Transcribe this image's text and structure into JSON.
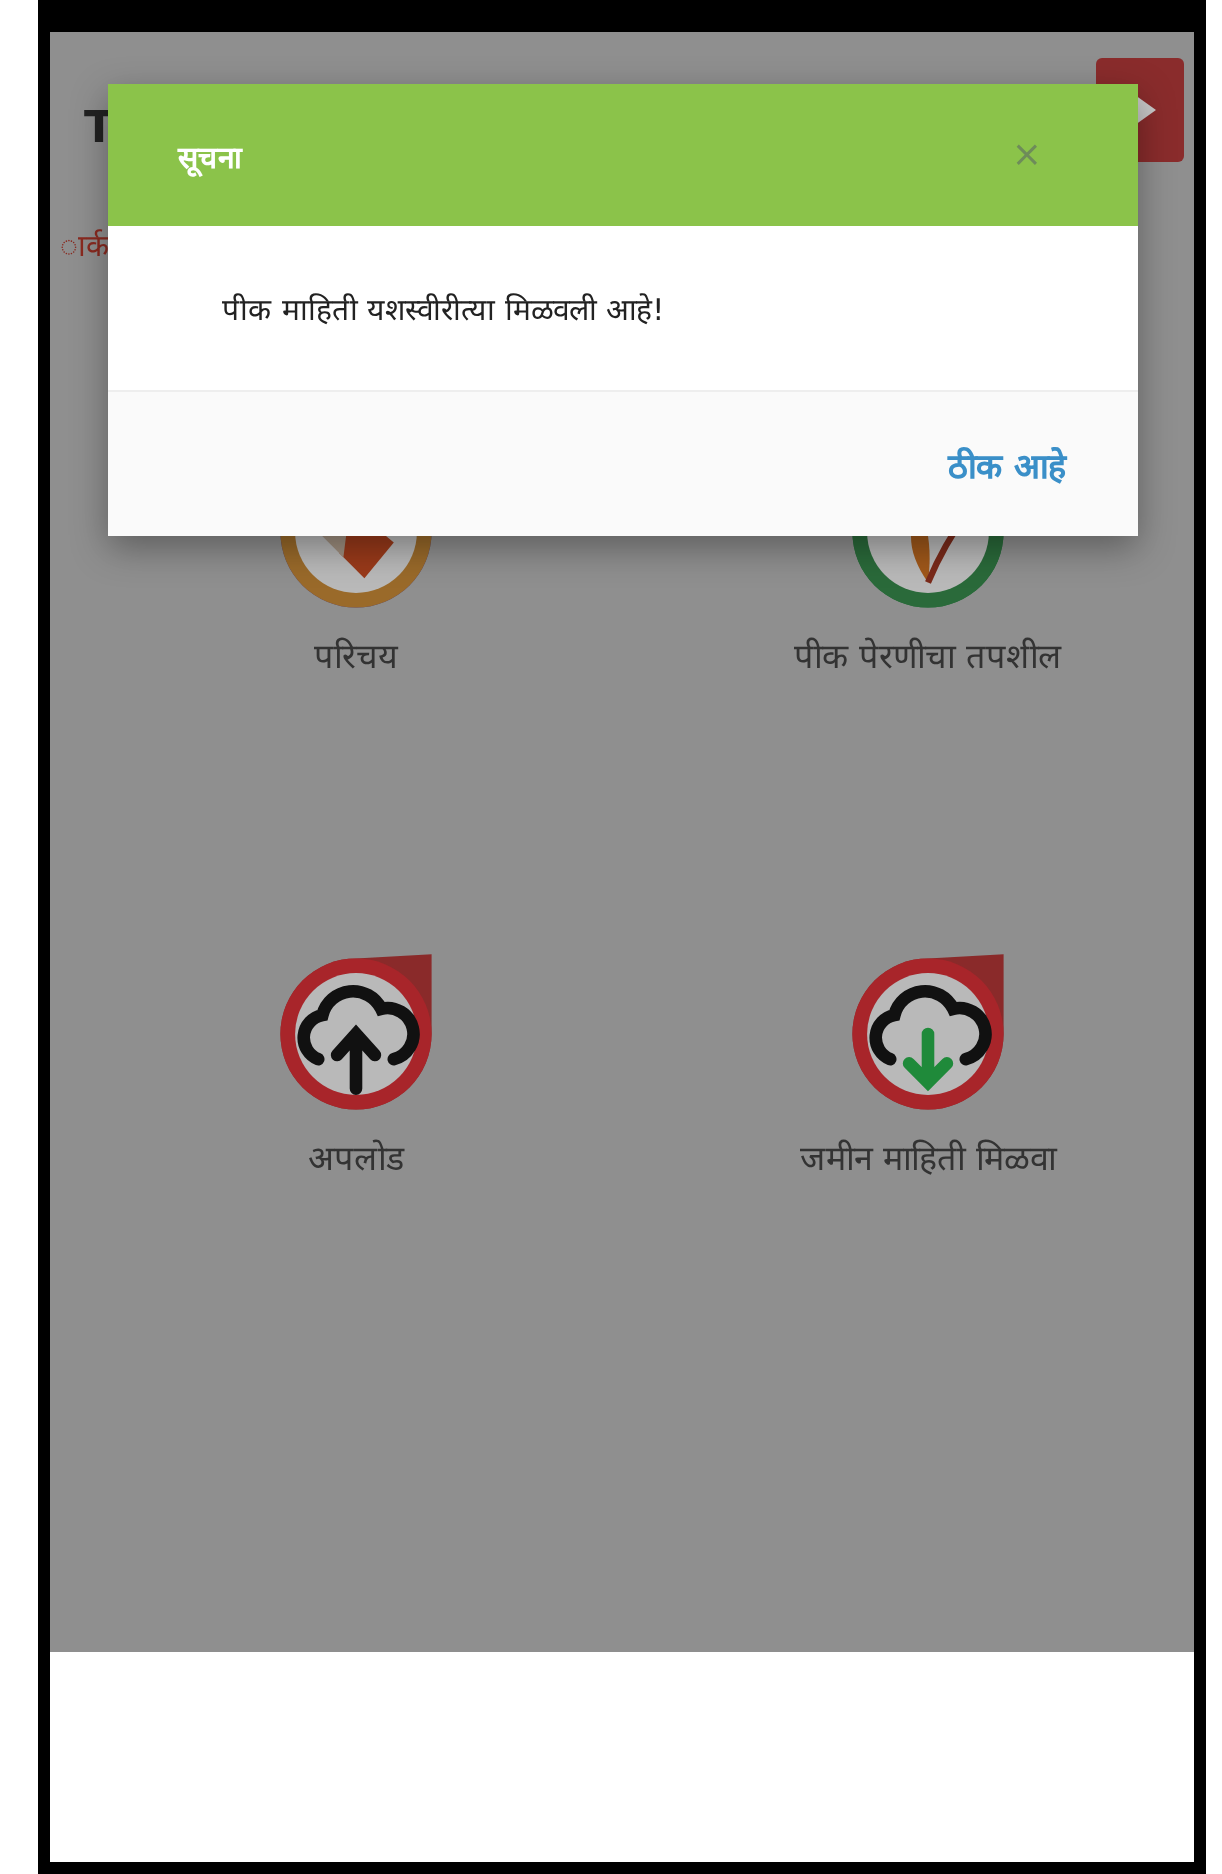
{
  "header": {
    "title": "T"
  },
  "subtitle": "ार्क",
  "tiles": [
    {
      "label": "परिचय",
      "kind": "intro"
    },
    {
      "label": "पीक पेरणीचा तपशील",
      "kind": "crop"
    },
    {
      "label": "अपलोड",
      "kind": "upload"
    },
    {
      "label": "जमीन माहिती मिळवा",
      "kind": "download"
    }
  ],
  "dialog": {
    "title": "सूचना",
    "close": "×",
    "message": "पीक माहिती यशस्वीरीत्या मिळवली आहे!",
    "button": "ठीक आहे"
  }
}
